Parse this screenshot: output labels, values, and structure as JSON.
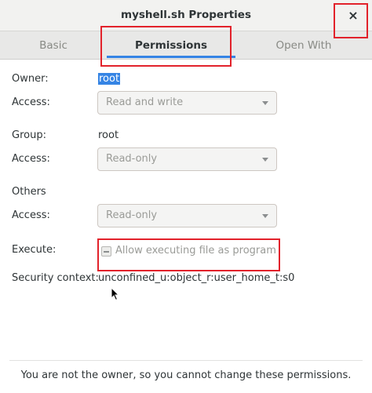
{
  "window": {
    "title": "myshell.sh Properties",
    "close_glyph": "×"
  },
  "tabs": [
    {
      "label": "Basic",
      "active": false
    },
    {
      "label": "Permissions",
      "active": true
    },
    {
      "label": "Open With",
      "active": false
    }
  ],
  "owner": {
    "label": "Owner:",
    "value": "root",
    "access_label": "Access:",
    "access_value": "Read and write"
  },
  "group": {
    "label": "Group:",
    "value": "root",
    "access_label": "Access:",
    "access_value": "Read-only"
  },
  "others": {
    "label": "Others",
    "access_label": "Access:",
    "access_value": "Read-only"
  },
  "execute": {
    "label": "Execute:",
    "checkbox_label": "Allow executing file as program",
    "checkbox_state": "mixed"
  },
  "security_context": {
    "label": "Security context:",
    "value": "unconfined_u:object_r:user_home_t:s0"
  },
  "footer": {
    "message": "You are not the owner, so you cannot change these permissions."
  },
  "colors": {
    "accent": "#3584e4",
    "annotation": "#e2222b"
  }
}
